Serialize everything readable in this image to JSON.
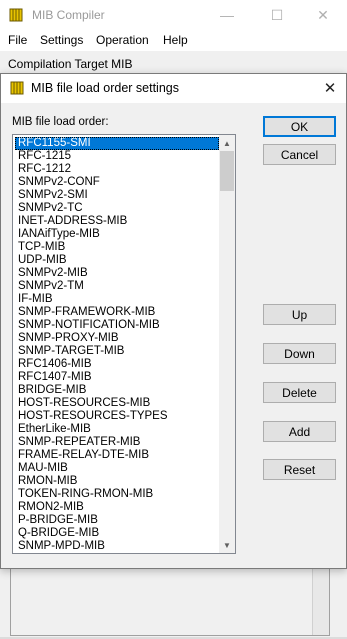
{
  "main_window": {
    "title": "MIB Compiler",
    "controls": {
      "minimize": "—",
      "maximize": "☐",
      "close": "✕"
    },
    "menu": [
      "File",
      "Settings",
      "Operation",
      "Help"
    ],
    "section_label": "Compilation Target MIB"
  },
  "dialog": {
    "title": "MIB file load order settings",
    "close_glyph": "✕",
    "list_label": "MIB file load order:",
    "items": [
      "RFC1155-SMI",
      "RFC-1215",
      "RFC-1212",
      "SNMPv2-CONF",
      "SNMPv2-SMI",
      "SNMPv2-TC",
      "INET-ADDRESS-MIB",
      "IANAifType-MIB",
      "TCP-MIB",
      "UDP-MIB",
      "SNMPv2-MIB",
      "SNMPv2-TM",
      "IF-MIB",
      "SNMP-FRAMEWORK-MIB",
      "SNMP-NOTIFICATION-MIB",
      "SNMP-PROXY-MIB",
      "SNMP-TARGET-MIB",
      "RFC1406-MIB",
      "RFC1407-MIB",
      "BRIDGE-MIB",
      "HOST-RESOURCES-MIB",
      "HOST-RESOURCES-TYPES",
      "EtherLike-MIB",
      "SNMP-REPEATER-MIB",
      "FRAME-RELAY-DTE-MIB",
      "MAU-MIB",
      "RMON-MIB",
      "TOKEN-RING-RMON-MIB",
      "RMON2-MIB",
      "P-BRIDGE-MIB",
      "Q-BRIDGE-MIB",
      "SNMP-MPD-MIB"
    ],
    "selected_index": 0,
    "buttons": {
      "ok": "OK",
      "cancel": "Cancel",
      "up": "Up",
      "down": "Down",
      "delete": "Delete",
      "add": "Add",
      "reset": "Reset"
    },
    "scroll_up": "▲",
    "scroll_down": "▼"
  },
  "colors": {
    "selection": "#0078d7",
    "default_button_border": "#0078d7",
    "icon_yellow": "#e8c400"
  }
}
